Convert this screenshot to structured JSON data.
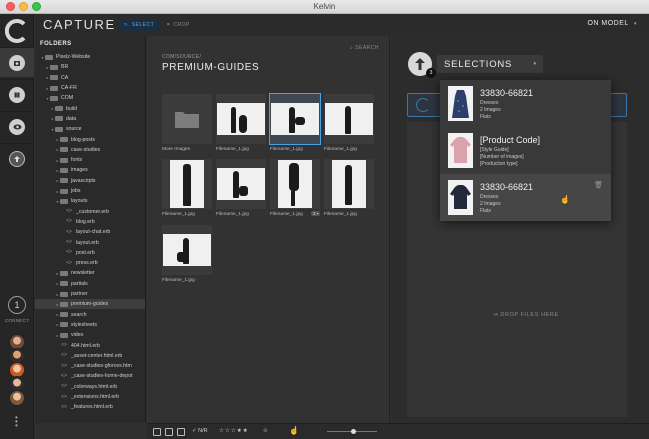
{
  "window": {
    "title": "Kelvin"
  },
  "header": {
    "brand": "CAPTURE",
    "select_label": "SELECT",
    "crop_label": "CROP",
    "model_dropdown": "ON MODEL"
  },
  "rail": {
    "connect_count": "1",
    "connect_label": "CONNECT"
  },
  "folders": {
    "title": "FOLDERS",
    "items": [
      {
        "label": "Pixelz-Website",
        "type": "folder",
        "expanded": true
      },
      {
        "label": "BR",
        "type": "folder"
      },
      {
        "label": "CA",
        "type": "folder"
      },
      {
        "label": "CA-FR",
        "type": "folder"
      },
      {
        "label": "COM",
        "type": "folder",
        "expanded": true
      },
      {
        "label": "build",
        "type": "folder"
      },
      {
        "label": "data",
        "type": "folder"
      },
      {
        "label": "source",
        "type": "folder",
        "expanded": true
      },
      {
        "label": "blog-posts",
        "type": "folder"
      },
      {
        "label": "case-studies",
        "type": "folder"
      },
      {
        "label": "fonts",
        "type": "folder"
      },
      {
        "label": "images",
        "type": "folder"
      },
      {
        "label": "javascripts",
        "type": "folder"
      },
      {
        "label": "jobs",
        "type": "folder"
      },
      {
        "label": "layouts",
        "type": "folder",
        "expanded": true
      },
      {
        "label": "_customer.erb",
        "type": "file"
      },
      {
        "label": "blog.erb",
        "type": "file"
      },
      {
        "label": "layout-chat.erb",
        "type": "file"
      },
      {
        "label": "layout.erb",
        "type": "file"
      },
      {
        "label": "post.erb",
        "type": "file"
      },
      {
        "label": "press.erb",
        "type": "file"
      },
      {
        "label": "newsletter",
        "type": "folder"
      },
      {
        "label": "partials",
        "type": "folder"
      },
      {
        "label": "partner",
        "type": "folder"
      },
      {
        "label": "premium-guides",
        "type": "folder",
        "selected": true
      },
      {
        "label": "search",
        "type": "folder"
      },
      {
        "label": "stylesheets",
        "type": "folder"
      },
      {
        "label": "video",
        "type": "folder"
      },
      {
        "label": "404.html.erb",
        "type": "file"
      },
      {
        "label": "_asset-center.html.erb",
        "type": "file"
      },
      {
        "label": "_case-studies-gforces.htm",
        "type": "file"
      },
      {
        "label": "_case-studies-home-depot",
        "type": "file"
      },
      {
        "label": "_colorways.html.erb",
        "type": "file"
      },
      {
        "label": "_extensions.html.erb",
        "type": "file"
      },
      {
        "label": "_features.html.erb",
        "type": "file"
      }
    ]
  },
  "thumbs": {
    "path_small": "COM/SOURCE/",
    "path_big": "PREMIUM-GUIDES",
    "search_label": "SEARCH",
    "more_images_label": "More Images",
    "file_label": "Filename_1.jpg",
    "badge_count": "2"
  },
  "selections": {
    "label": "SELECTIONS",
    "upload_count": "3",
    "drop_label": "DROP FILES HERE",
    "items": [
      {
        "title": "33830-66821",
        "line1": "Dresses",
        "line2": "2 Images",
        "line3": "Flats"
      },
      {
        "title": "[Product Code]",
        "line1": "[Style Guide]",
        "line2": "[Number of images]",
        "line3": "[Production type]"
      },
      {
        "title": "33830-66821",
        "line1": "Dresses",
        "line2": "2 Images",
        "line3": "Flats"
      }
    ]
  },
  "footer": {
    "nr_label": "N/R",
    "stars": "☆☆☆★★"
  },
  "colors": {
    "accent": "#4aa0e0",
    "background": "#2f2f2f"
  }
}
